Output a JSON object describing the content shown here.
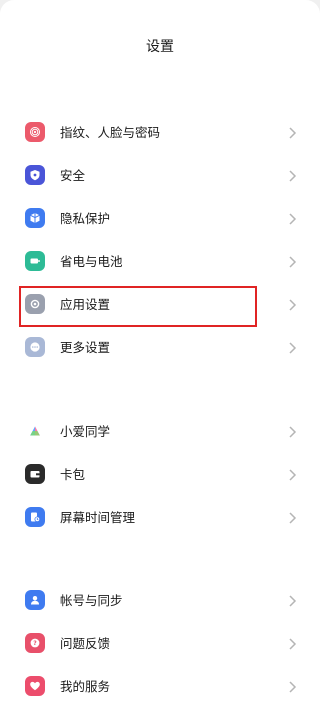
{
  "header": {
    "title": "设置"
  },
  "groups": [
    {
      "items": [
        {
          "label": "指纹、人脸与密码",
          "icon": "fingerprint-icon",
          "color": "#ec5a6b"
        },
        {
          "label": "安全",
          "icon": "shield-icon",
          "color": "#4a55d8"
        },
        {
          "label": "隐私保护",
          "icon": "privacy-cube-icon",
          "color": "#3f7bf0"
        },
        {
          "label": "省电与电池",
          "icon": "battery-icon",
          "color": "#2dbb96"
        },
        {
          "label": "应用设置",
          "icon": "gear-icon",
          "color": "#9aa0ae",
          "highlighted": true
        },
        {
          "label": "更多设置",
          "icon": "more-dots-icon",
          "color": "#a9b8d6"
        }
      ]
    },
    {
      "items": [
        {
          "label": "小爱同学",
          "icon": "xiaoai-icon",
          "color": "#ffffff"
        },
        {
          "label": "卡包",
          "icon": "wallet-icon",
          "color": "#2b2b2b"
        },
        {
          "label": "屏幕时间管理",
          "icon": "screen-time-icon",
          "color": "#3f7bf0"
        }
      ]
    },
    {
      "items": [
        {
          "label": "帐号与同步",
          "icon": "account-icon",
          "color": "#3f7bf0"
        },
        {
          "label": "问题反馈",
          "icon": "feedback-icon",
          "color": "#e8506a"
        },
        {
          "label": "我的服务",
          "icon": "heart-icon",
          "color": "#ec4d6c"
        }
      ]
    }
  ],
  "colors": {
    "highlight_border": "#e02424",
    "chevron": "#b5b5b5"
  }
}
